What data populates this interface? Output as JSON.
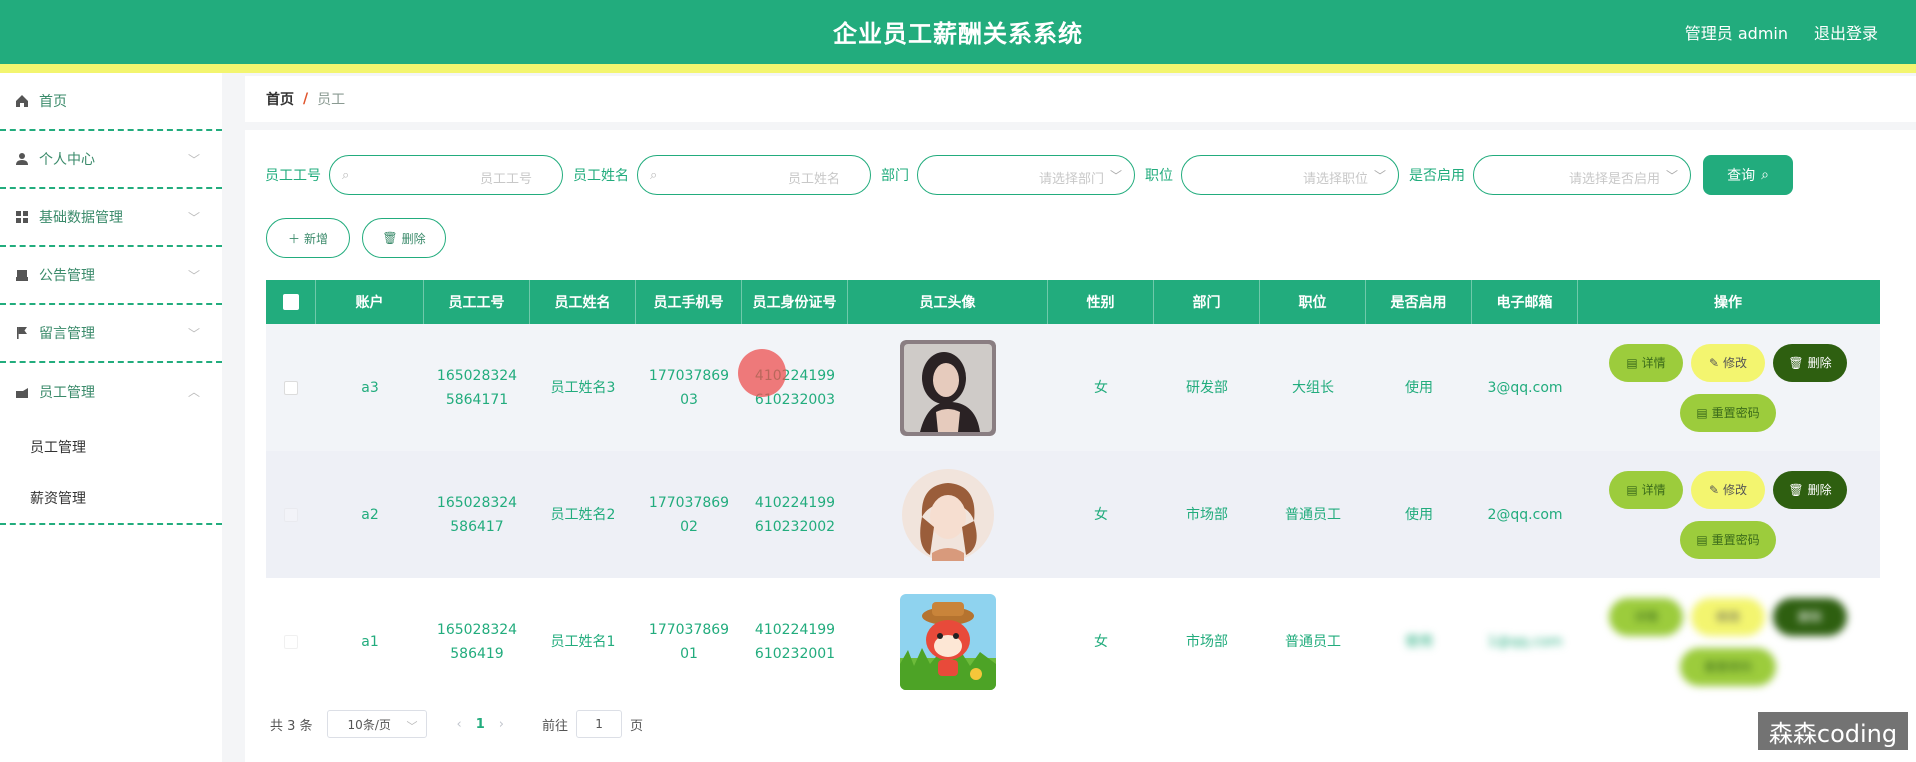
{
  "header": {
    "title": "企业员工薪酬关系系统",
    "user": "管理员 admin",
    "logout": "退出登录",
    "accent": "#22ac7d",
    "stripe": "#f3f56f"
  },
  "sidebar": {
    "items": [
      {
        "label": "首页",
        "icon": "home-icon"
      },
      {
        "label": "个人中心",
        "icon": "user-icon"
      },
      {
        "label": "基础数据管理",
        "icon": "grid-icon"
      },
      {
        "label": "公告管理",
        "icon": "notice-icon"
      },
      {
        "label": "留言管理",
        "icon": "flag-icon"
      },
      {
        "label": "员工管理",
        "icon": "staff-icon"
      }
    ],
    "sub_items": [
      {
        "label": "员工管理"
      },
      {
        "label": "薪资管理"
      }
    ]
  },
  "breadcrumb": {
    "home": "首页",
    "sep": "/",
    "current": "员工"
  },
  "search": {
    "emp_no_label": "员工工号",
    "emp_no_placeholder": "员工工号",
    "emp_name_label": "员工姓名",
    "emp_name_placeholder": "员工姓名",
    "dept_label": "部门",
    "dept_placeholder": "请选择部门",
    "pos_label": "职位",
    "pos_placeholder": "请选择职位",
    "enabled_label": "是否启用",
    "enabled_placeholder": "请选择是否启用",
    "query_label": "查询"
  },
  "actions": {
    "add_label": "新增",
    "delete_label": "删除"
  },
  "table": {
    "columns": [
      "账户",
      "员工工号",
      "员工姓名",
      "员工手机号",
      "员工身份证号",
      "员工头像",
      "性别",
      "部门",
      "职位",
      "是否启用",
      "电子邮箱",
      "操作"
    ],
    "rows": [
      {
        "account": "a3",
        "emp_no": "1650283245864171",
        "name": "员工姓名3",
        "phone": "17703786903",
        "id_card": "410224199610232003",
        "gender": "女",
        "dept": "研发部",
        "position": "大组长",
        "enabled": "使用",
        "email": "3@qq.com"
      },
      {
        "account": "a2",
        "emp_no": "165028324586417",
        "name": "员工姓名2",
        "phone": "17703786902",
        "id_card": "410224199610232002",
        "gender": "女",
        "dept": "市场部",
        "position": "普通员工",
        "enabled": "使用",
        "email": "2@qq.com"
      },
      {
        "account": "a1",
        "emp_no": "165028324586419",
        "name": "员工姓名1",
        "phone": "17703786901",
        "id_card": "410224199610232001",
        "gender": "女",
        "dept": "市场部",
        "position": "普通员工",
        "enabled": "使用",
        "email": "1@qq.com"
      }
    ],
    "ops": {
      "detail": "详情",
      "edit": "修改",
      "delete": "删除",
      "reset": "重置密码"
    }
  },
  "pagination": {
    "total": "共 3 条",
    "page_size": "10条/页",
    "current": "1",
    "goto_label": "前往",
    "goto_value": "1",
    "page_suffix": "页"
  },
  "watermark": "森森coding"
}
